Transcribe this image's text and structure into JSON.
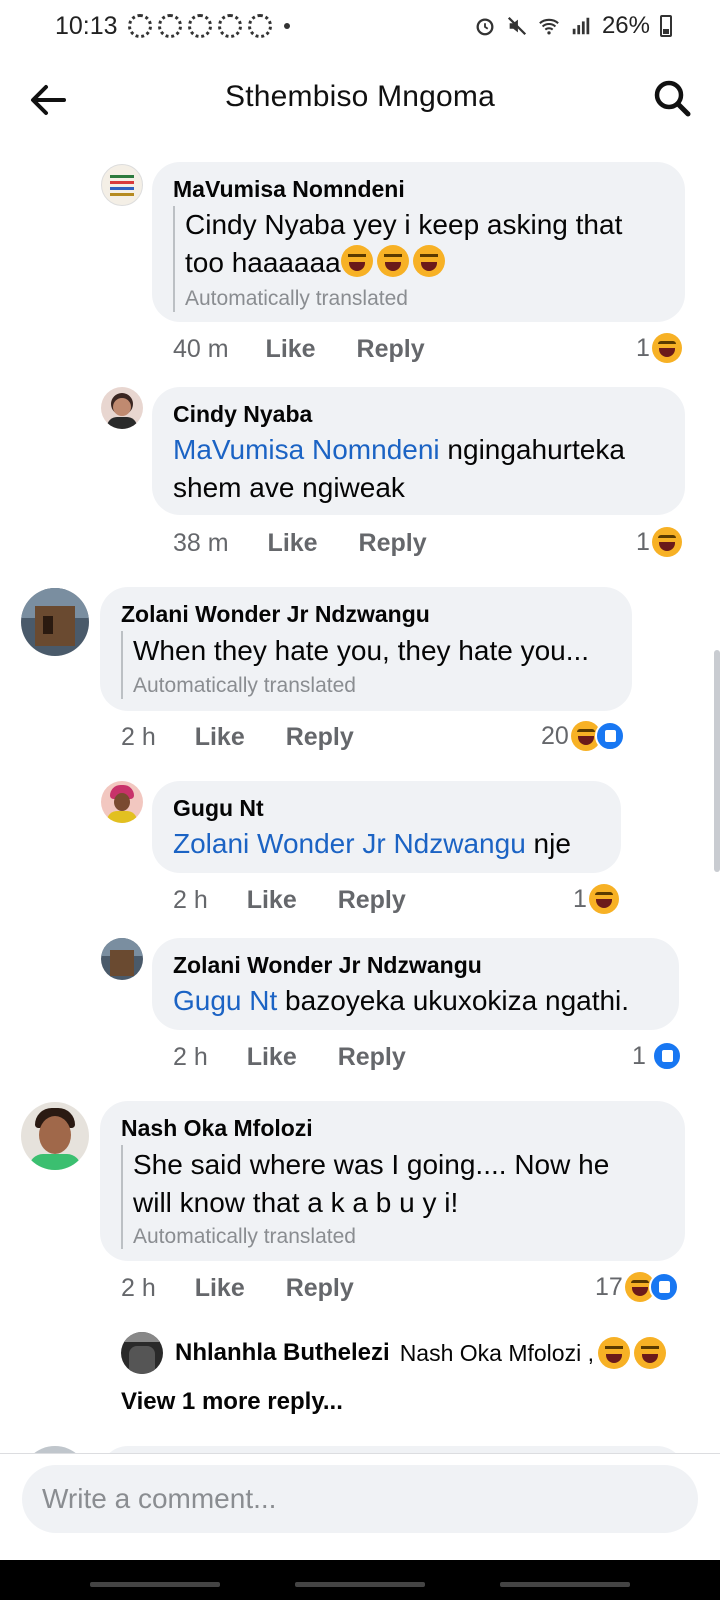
{
  "status_bar": {
    "time": "10:13",
    "battery": "26%"
  },
  "header": {
    "title": "Sthembiso Mngoma"
  },
  "comments": [
    {
      "author": "MaVumisa  Nomndeni",
      "text": "Cindy Nyaba yey i keep asking that too haaaaaa",
      "translated": "Automatically translated",
      "time": "40 m",
      "like": "Like",
      "reply": "Reply",
      "reaction_count": "1"
    },
    {
      "author": "Cindy Nyaba",
      "mention": "MaVumisa Nomndeni",
      "text": " ngingahurteka shem ave ngiweak",
      "time": "38 m",
      "like": "Like",
      "reply": "Reply",
      "reaction_count": "1"
    },
    {
      "author": "Zolani Wonder Jr Ndzwangu",
      "text": "When they hate you, they hate you...",
      "translated": "Automatically translated",
      "time": "2 h",
      "like": "Like",
      "reply": "Reply",
      "reaction_count": "20"
    },
    {
      "author": "Gugu Nt",
      "mention": "Zolani Wonder Jr Ndzwangu",
      "text": " nje",
      "time": "2 h",
      "like": "Like",
      "reply": "Reply",
      "reaction_count": "1"
    },
    {
      "author": "Zolani Wonder Jr Ndzwangu",
      "mention": "Gugu Nt",
      "text": " bazoyeka ukuxokiza ngathi.",
      "time": "2 h",
      "like": "Like",
      "reply": "Reply",
      "reaction_count": "1"
    },
    {
      "author": "Nash Oka Mfolozi",
      "text": "She said where was I going.... Now he will know that a k a b u y i!",
      "translated": "Automatically translated",
      "time": "2 h",
      "like": "Like",
      "reply": "Reply",
      "reaction_count": "17"
    }
  ],
  "reply_preview": {
    "name": "Nhlanhla Buthelezi",
    "text": "Nash Oka Mfolozi ,"
  },
  "view_more": "View 1 more reply...",
  "composer": {
    "placeholder": "Write a comment..."
  }
}
